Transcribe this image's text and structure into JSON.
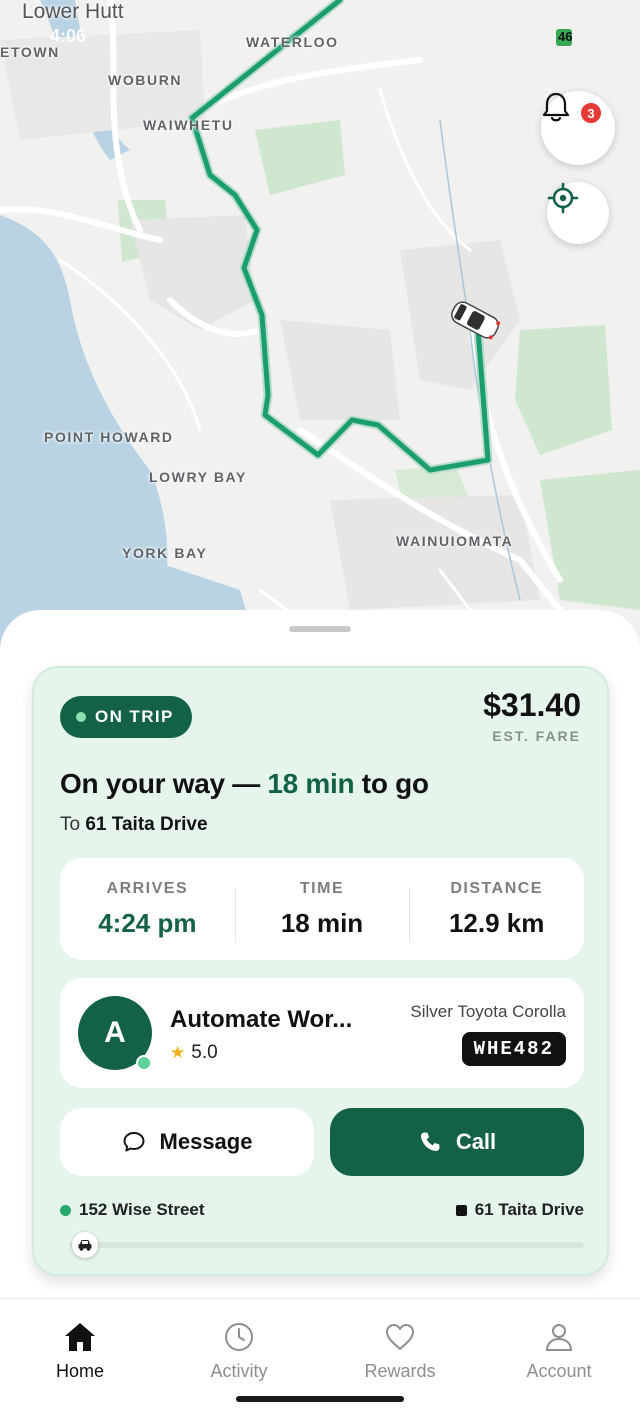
{
  "status_bar": {
    "time": "4:06",
    "battery": "46"
  },
  "map": {
    "places": {
      "lower_hutt": "Lower Hutt",
      "etown": "ETOWN",
      "waterloo": "WATERLOO",
      "woburn": "WOBURN",
      "waiwhetu": "WAIWHETU",
      "point_howard": "POINT HOWARD",
      "lowry_bay": "LOWRY BAY",
      "york_bay": "YORK BAY",
      "wainuiomata": "WAINUIOMATA"
    },
    "notification_count": "3",
    "route_color": "#1b9e6e"
  },
  "trip": {
    "status": "ON TRIP",
    "fare": "$31.40",
    "fare_label": "EST. FARE",
    "headline_prefix": "On your way —",
    "headline_eta": "18 min",
    "headline_suffix": "to go",
    "dest_prefix": "To",
    "destination": "61 Taita Drive",
    "stats": [
      {
        "label": "ARRIVES",
        "value": "4:24 pm"
      },
      {
        "label": "TIME",
        "value": "18 min"
      },
      {
        "label": "DISTANCE",
        "value": "12.9 km"
      }
    ],
    "progress": 0.03
  },
  "driver": {
    "initial": "A",
    "name": "Automate Wor...",
    "rating": "5.0",
    "vehicle": "Silver Toyota Corolla",
    "plate": "WHE482"
  },
  "actions": {
    "message": "Message",
    "call": "Call"
  },
  "route": {
    "from": "152 Wise Street",
    "to": "61 Taita Drive"
  },
  "tabs": [
    {
      "label": "Home",
      "icon": "home-icon",
      "active": true
    },
    {
      "label": "Activity",
      "icon": "clock-icon",
      "active": false
    },
    {
      "label": "Rewards",
      "icon": "heart-icon",
      "active": false
    },
    {
      "label": "Account",
      "icon": "person-icon",
      "active": false
    }
  ],
  "colors": {
    "brand": "#136246",
    "card_bg": "#e6f5ec",
    "accent_dot": "#26a86d"
  }
}
